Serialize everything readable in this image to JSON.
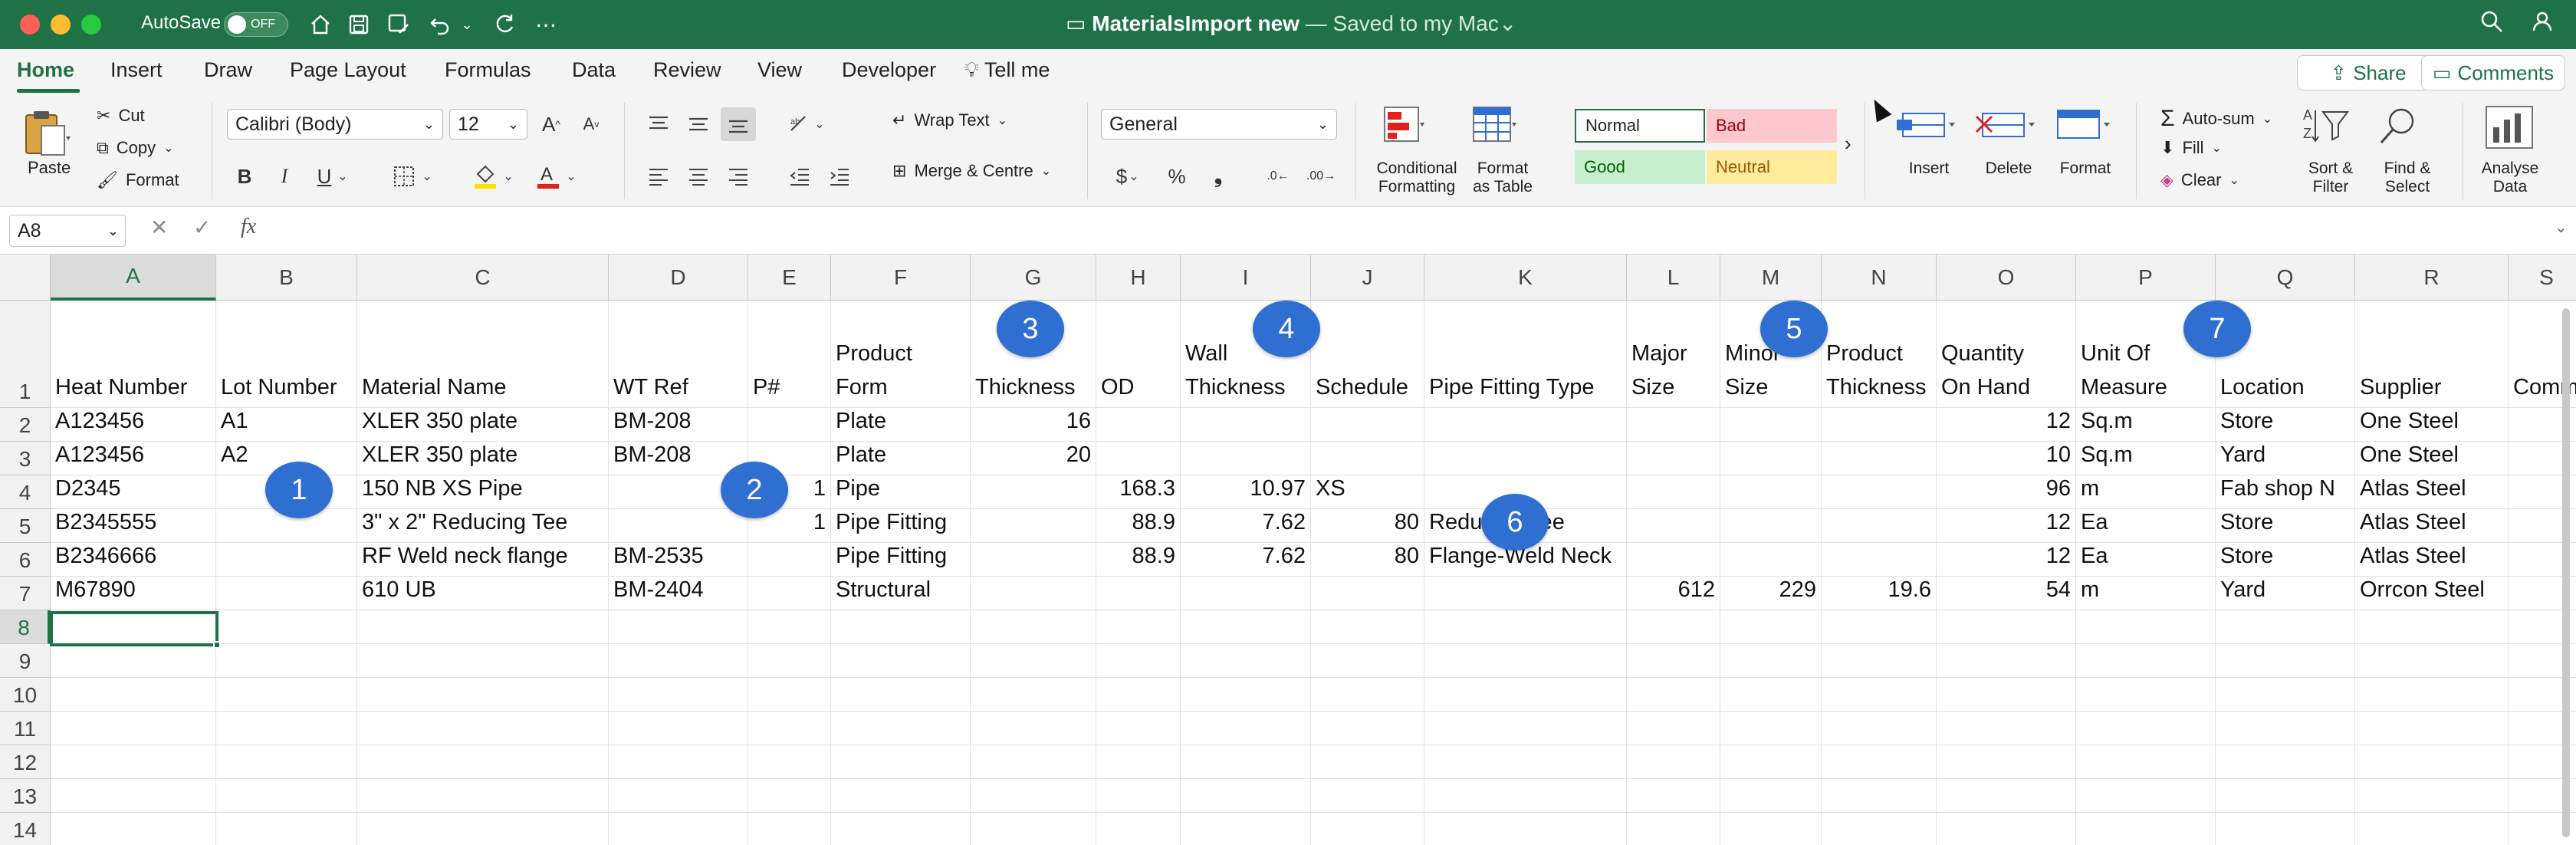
{
  "titlebar": {
    "autosave_label": "AutoSave",
    "autosave_state": "OFF",
    "doc_name": "MaterialsImport new",
    "saved_status": " — Saved to my Mac",
    "chevron": "⌄"
  },
  "tabs": [
    "Home",
    "Insert",
    "Draw",
    "Page Layout",
    "Formulas",
    "Data",
    "Review",
    "View",
    "Developer",
    "Tell me"
  ],
  "share_label": "Share",
  "comments_label": "Comments",
  "ribbon": {
    "paste": "Paste",
    "cut": "Cut",
    "copy": "Copy",
    "format": "Format",
    "font_name": "Calibri (Body)",
    "font_size": "12",
    "wrap_text": "Wrap Text",
    "merge_centre": "Merge & Centre",
    "number_format": "General",
    "conditional_formatting": "Conditional\nFormatting",
    "format_as_table": "Format\nas Table",
    "style_normal": "Normal",
    "style_bad": "Bad",
    "style_good": "Good",
    "style_neutral": "Neutral",
    "insert": "Insert",
    "delete": "Delete",
    "format_cells": "Format",
    "autosum": "Auto-sum",
    "fill": "Fill",
    "clear": "Clear",
    "sort_filter": "Sort &\nFilter",
    "find_select": "Find &\nSelect",
    "analyse_data": "Analyse\nData"
  },
  "formula_bar": {
    "name_box": "A8",
    "fx": "fx",
    "content": ""
  },
  "grid": {
    "columns": [
      "A",
      "B",
      "C",
      "D",
      "E",
      "F",
      "G",
      "H",
      "I",
      "J",
      "K",
      "L",
      "M",
      "N",
      "O",
      "P",
      "Q",
      "R",
      "S"
    ],
    "rows": [
      "1",
      "2",
      "3",
      "4",
      "5",
      "6",
      "7",
      "8",
      "9",
      "10",
      "11",
      "12",
      "13",
      "14"
    ],
    "header_row": [
      "Heat Number",
      "Lot Number",
      "Material Name",
      "WT Ref",
      "P#",
      "Product\nForm",
      "Thickness",
      "OD",
      "Wall\nThickness",
      "Schedule",
      "Pipe Fitting Type",
      "Major\nSize",
      "Minor\nSize",
      "Product\nThickness",
      "Quantity\nOn Hand",
      "Unit Of\nMeasure",
      "Location",
      "Supplier",
      "Comm"
    ],
    "data_rows": [
      [
        "A123456",
        "A1",
        "XLER 350 plate",
        "BM-208",
        "",
        "Plate",
        "16",
        "",
        "",
        "",
        "",
        "",
        "",
        "",
        "12",
        "Sq.m",
        "Store",
        "One Steel",
        ""
      ],
      [
        "A123456",
        "A2",
        "XLER 350 plate",
        "BM-208",
        "",
        "Plate",
        "20",
        "",
        "",
        "",
        "",
        "",
        "",
        "",
        "10",
        "Sq.m",
        "Yard",
        "One Steel",
        ""
      ],
      [
        "D2345",
        "",
        "150 NB XS Pipe",
        "",
        "1",
        "Pipe",
        "",
        "168.3",
        "10.97",
        "XS",
        "",
        "",
        "",
        "",
        "96",
        "m",
        "Fab shop N",
        "Atlas Steel",
        ""
      ],
      [
        "B2345555",
        "",
        "3\" x 2\" Reducing Tee",
        "",
        "1",
        "Pipe Fitting",
        "",
        "88.9",
        "7.62",
        "80",
        "Reducing Tee",
        "",
        "",
        "",
        "12",
        "Ea",
        "Store",
        "Atlas Steel",
        ""
      ],
      [
        "B2346666",
        "",
        "RF Weld neck flange",
        "BM-2535",
        "",
        "Pipe Fitting",
        "",
        "88.9",
        "7.62",
        "80",
        "Flange-Weld Neck",
        "",
        "",
        "",
        "12",
        "Ea",
        "Store",
        "Atlas Steel",
        ""
      ],
      [
        "M67890",
        "",
        "610 UB",
        "BM-2404",
        "",
        "Structural",
        "",
        "",
        "",
        "",
        "",
        "612",
        "229",
        "19.6",
        "54",
        "m",
        "Yard",
        "Orrcon Steel",
        ""
      ]
    ],
    "active_cell": "A8"
  },
  "markers": [
    "1",
    "2",
    "3",
    "4",
    "5",
    "6",
    "7"
  ],
  "colors": {
    "excel_green": "#1f7246",
    "marker_blue": "#2f6fd1",
    "bad_bg": "#ffc7ce",
    "bad_fg": "#9c0006",
    "good_bg": "#c6efce",
    "good_fg": "#006100",
    "neutral_bg": "#ffeb9c",
    "neutral_fg": "#9c5700"
  }
}
